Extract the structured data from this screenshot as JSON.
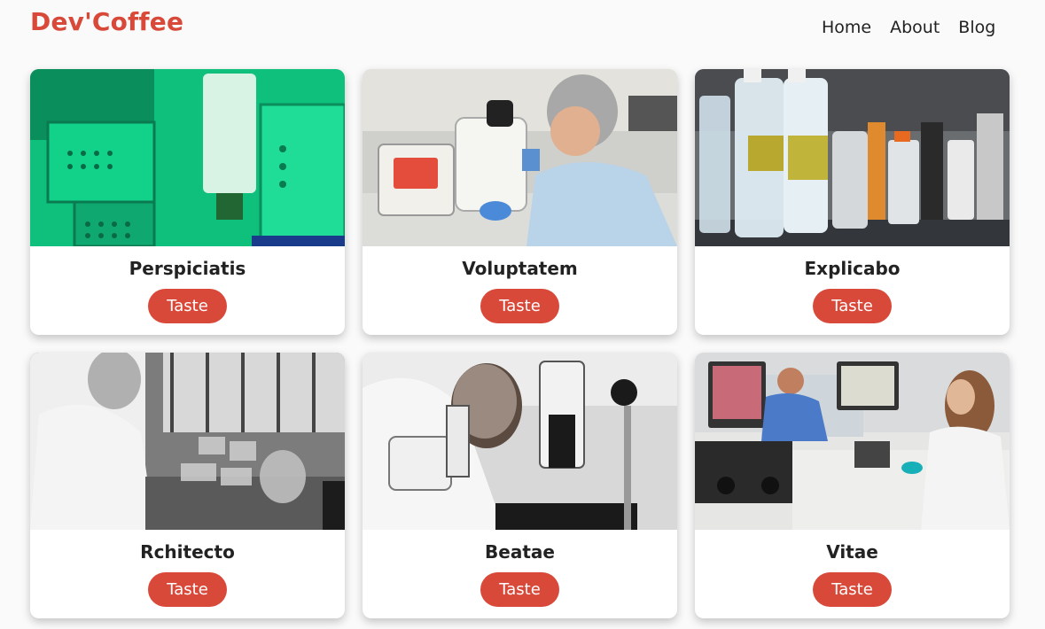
{
  "header": {
    "logo": "Dev'Coffee",
    "nav": [
      {
        "label": "Home"
      },
      {
        "label": "About"
      },
      {
        "label": "Blog"
      }
    ]
  },
  "cards": [
    {
      "title": "Perspiciatis",
      "button": "Taste",
      "image": "lab-automation-green"
    },
    {
      "title": "Voluptatem",
      "button": "Taste",
      "image": "scientist-microscope-color"
    },
    {
      "title": "Explicabo",
      "button": "Taste",
      "image": "lab-bottles-shelf"
    },
    {
      "title": "Rchitecto",
      "button": "Taste",
      "image": "scientist-lab-bw"
    },
    {
      "title": "Beatae",
      "button": "Taste",
      "image": "scientist-microscope-bw"
    },
    {
      "title": "Vitae",
      "button": "Taste",
      "image": "modern-lab-microscopes"
    }
  ],
  "colors": {
    "brand": "#d9493a",
    "background": "#fafafa",
    "text": "#222222"
  }
}
